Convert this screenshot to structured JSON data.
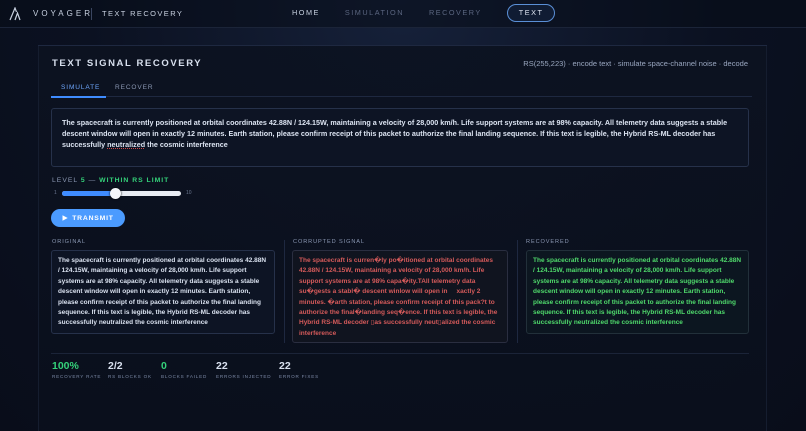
{
  "app": {
    "brand": "VOYAGER",
    "section": "TEXT RECOVERY"
  },
  "nav": {
    "home": "HOME",
    "simulation": "SIMULATION",
    "recovery": "RECOVERY",
    "text": "TEXT"
  },
  "panel": {
    "title": "TEXT SIGNAL RECOVERY",
    "meta": "RS(255,223) · encode text · simulate space-channel noise · decode",
    "tabs": [
      "SIMULATE",
      "RECOVER"
    ]
  },
  "input": {
    "text_before": "The spacecraft is currently positioned at orbital coordinates 42.88N / 124.15W, maintaining a velocity of 28,000 km/h. Life support systems are at 98% capacity. All telemetry data suggests a stable descent window will open in exactly 12 minutes. Earth station, please confirm receipt of this packet to authorize the final landing sequence. If this text is legible, the Hybrid RS-ML decoder has successfully ",
    "text_spell": "neutralized",
    "text_after": " the cosmic interference"
  },
  "level": {
    "label": "LEVEL",
    "value": "5",
    "sep": "—",
    "status": "WITHIN RS LIMIT",
    "min": "1",
    "max": "10",
    "fraction": 0.45
  },
  "transmit_label": "TRANSMIT",
  "columns": {
    "original": {
      "label": "ORIGINAL",
      "text": "The spacecraft is currently positioned at orbital coordinates 42.88N / 124.15W, maintaining a velocity of 28,000 km/h. Life support systems are at 98% capacity. All telemetry data suggests a stable descent window will open in exactly 12 minutes. Earth station, please confirm receipt of this packet to authorize the final landing sequence. If this text is legible, the Hybrid RS-ML decoder has successfully neutralized the cosmic interference"
    },
    "corrupted": {
      "label": "CORRUPTED SIGNAL",
      "text": "The spacecraft is curren�ly po�itioned at orbital coordinates 42.88N / 124.15W, maintaining a velocity of 28,000 km/h. Life support systems are at 98% capa�ity.TAll telemetry data su�gests a stabl� descent winlow will open in     xactly 2 minutes. �arth station, please confirm receipt of this pack?t to authorize the final�landing seq�ence. If this text is legible, the Hybrid RS-ML decoder ▯as successfully neut▯alized the cosmic interference"
    },
    "recovered": {
      "label": "RECOVERED",
      "text": "The spacecraft is currently positioned at orbital coordinates 42.88N / 124.15W, maintaining a velocity of 28,000 km/h. Life support systems are at 98% capacity. All telemetry data suggests a stable descent window will open in exactly 12 minutes. Earth station, please confirm receipt of this packet to authorize the final landing sequence. If this text is legible, the Hybrid RS-ML decoder has successfully neutralized the cosmic interference"
    }
  },
  "stats": [
    {
      "value": "100%",
      "label": "RECOVERY RATE"
    },
    {
      "value": "2/2",
      "label": "RS BLOCKS OK"
    },
    {
      "value": "0",
      "label": "BLOCKS FAILED"
    },
    {
      "value": "22",
      "label": "ERRORS INJECTED"
    },
    {
      "value": "22",
      "label": "ERROR FIXES"
    }
  ],
  "colors": {
    "accent": "#3f8cff",
    "success": "#34d27a",
    "error": "#d45a5a",
    "recovered": "#4fd96b"
  },
  "icons": {
    "logo": "voyager-logo-icon",
    "transmit": "play-icon"
  }
}
